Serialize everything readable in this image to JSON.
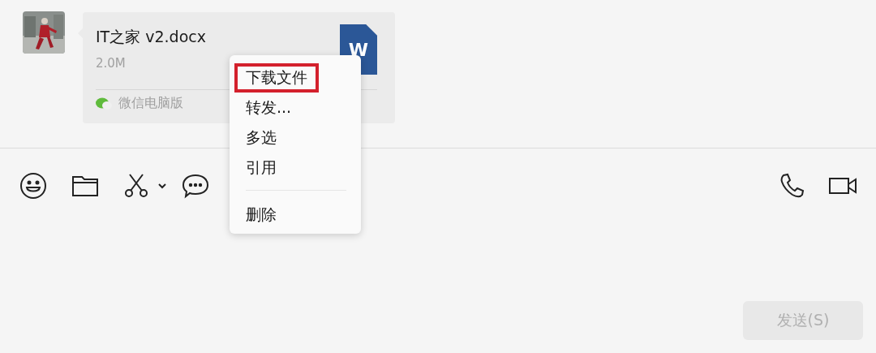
{
  "message": {
    "file_name": "IT之家 v2.docx",
    "file_size": "2.0M",
    "file_icon_letter": "W",
    "source": "微信电脑版"
  },
  "context_menu": {
    "items": [
      {
        "kind": "item",
        "label": "下载文件",
        "highlighted": true
      },
      {
        "kind": "item",
        "label": "转发...",
        "highlighted": false
      },
      {
        "kind": "item",
        "label": "多选",
        "highlighted": false
      },
      {
        "kind": "item",
        "label": "引用",
        "highlighted": false
      },
      {
        "kind": "separator"
      },
      {
        "kind": "item",
        "label": "删除",
        "highlighted": false
      }
    ]
  },
  "send_button": {
    "label": "发送(S)",
    "disabled": true
  }
}
